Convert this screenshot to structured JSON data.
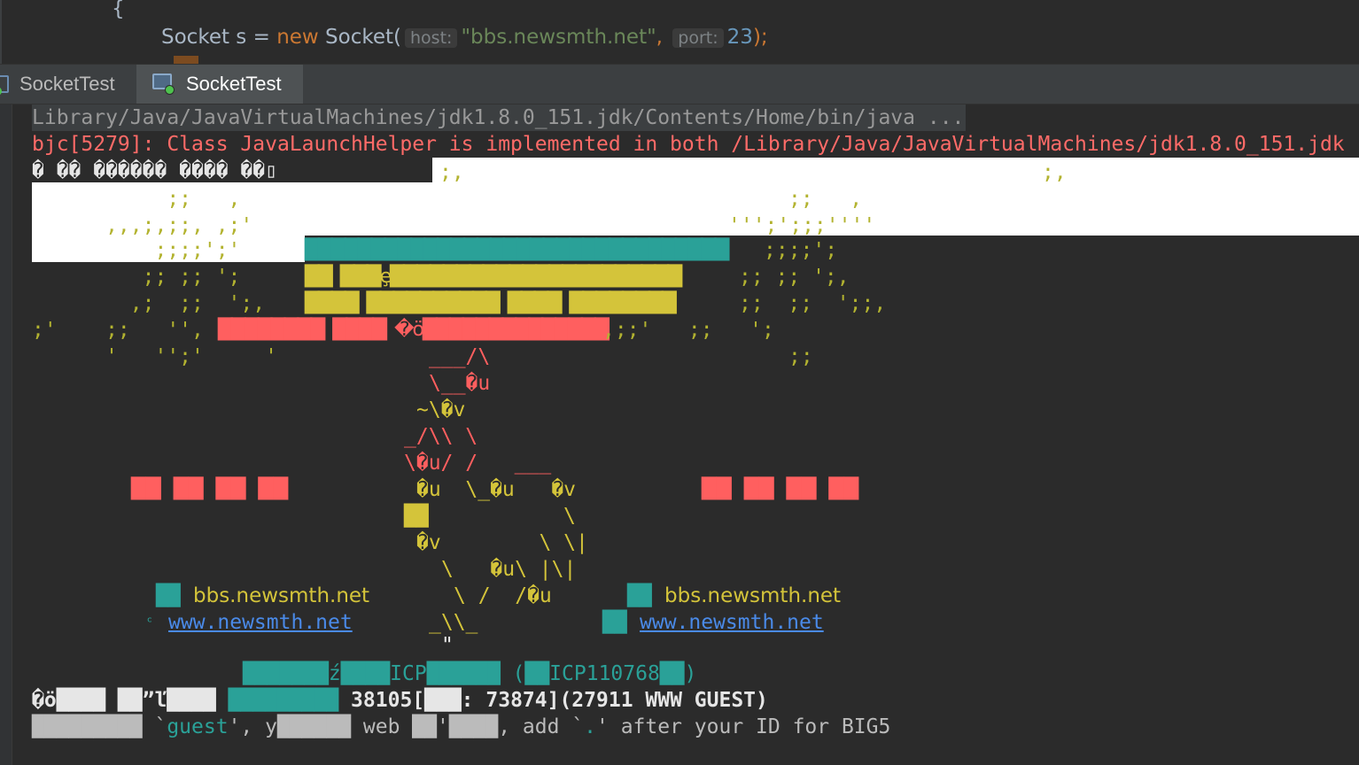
{
  "editor": {
    "brace": "{",
    "code_type": "Socket",
    "code_var": " s = ",
    "code_new": "new",
    "code_ctor": " Socket(",
    "hint_host": "host:",
    "host_value": "\"bbs.newsmth.net\"",
    "comma": ",",
    "hint_port": "port:",
    "port_value": "23",
    "close": ");"
  },
  "tabs": [
    {
      "label": "SocketTest"
    },
    {
      "label": "SocketTest"
    }
  ],
  "console": {
    "cmd": "Library/Java/JavaVirtualMachines/jdk1.8.0_151.jdk/Contents/Home/bin/java ...",
    "error": "bjc[5279]: Class JavaLaunchHelper is implemented in both /Library/Java/JavaVirtualMachines/jdk1.8.0_151.jdk",
    "garble1": "� �� ������ ���� ��▯",
    "art_top_r1": ";,",
    "art_top_r2": ";,",
    "art_l2": "           ;;   ,",
    "art_r2": "''';';;;''''",
    "art_l3": "      ,,,;,;;, ,;'",
    "art_r3": "",
    "art_l4": "          ;;;;';'",
    "banner1": "████████████████████████████████",
    "art_r4": ";;;;';",
    "art_l5": "         ;; ;; ';",
    "banner2a": "██  ███ȩ██████████████████████",
    "art_r5": ";; ;; ';,",
    "art_l6": "        ,;  ;;  ';,",
    "banner3": "████  ██████████  ████  ████████",
    "art_r6": ";;  ;;  ';;,",
    "art_l7": ";'    ;;   '',",
    "banner4": "████████  ████  �ö██████████████",
    "art_r7": ",;;'   ;;   ';",
    "art_l8": "      '   '';'     '",
    "art_r8": ";;",
    "deer1": "___/\\",
    "deer2": "\\__�u",
    "deer3": "~\\�v",
    "deer4": "_/\\\\ \\",
    "deer5": "\\�u/ /   ___",
    "boxes_left": "██  ██  ██  ██",
    "deer6": "�u  \\_�u   �v",
    "boxes_right": "██  ██  ██  ██",
    "deer7": "██           \\",
    "deer8": "�v        \\ \\|",
    "deer9": "\\   �u\\ |\\|",
    "site_prefix_l": "██",
    "bbs_left": "bbs.newsmth.net",
    "deer10": "\\ /  /�u",
    "site_prefix_r": "██",
    "bbs_right": "bbs.newsmth.net",
    "www_prefix_l": "ᶜ",
    "www_left": "www.newsmth.net",
    "deer11": "_\\\\_",
    "www_prefix_r": "██",
    "www_right": "www.newsmth.net",
    "deer12": "\"",
    "icp": "███████ź████ICP██████ (██ICP110768██)",
    "stat_pre": "�ö████ ██”ľ████",
    "stat_mid": "█████████",
    "stats": " 38105[███: 73874](27911 WWW GUEST)",
    "login_pre": "█████████ `",
    "login_guest": "guest",
    "login_post": "', у██████ web ██'████, add `",
    "login_dot": ".",
    "login_end": "' after your ID for BIG5"
  }
}
